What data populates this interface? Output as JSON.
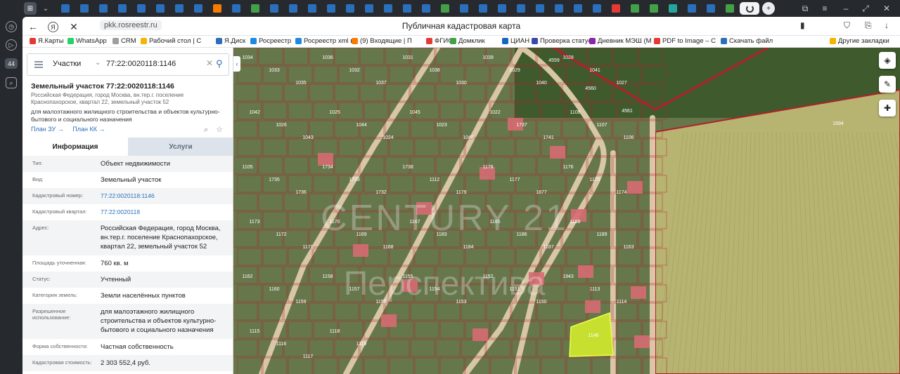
{
  "browser": {
    "page_title": "Публичная кадастровая карта",
    "url": "pkk.rosreestr.ru",
    "sidebar_badge": "44",
    "bookmarks": [
      {
        "label": "Я.Карты",
        "color": "#e53935"
      },
      {
        "label": "WhatsApp",
        "color": "#25d366"
      },
      {
        "label": "CRM",
        "color": "#9e9e9e"
      },
      {
        "label": "Рабочий стол | C",
        "color": "#f4b400"
      },
      {
        "label": "Я.Диск",
        "color": "#2b6fba"
      },
      {
        "label": "Росреестр",
        "color": "#1e88e5"
      },
      {
        "label": "Росреестр xml в",
        "color": "#1e88e5"
      },
      {
        "label": "(9) Входящие | П",
        "color": "#f57c00"
      },
      {
        "label": "ФГИС",
        "color": "#e53935"
      },
      {
        "label": "Домклик",
        "color": "#43a047"
      },
      {
        "label": "ЦИАН",
        "color": "#1565c0"
      },
      {
        "label": "Проверка статуса",
        "color": "#3949ab"
      },
      {
        "label": "Дневник МЭШ (М",
        "color": "#8e24aa"
      },
      {
        "label": "PDF to Image – C",
        "color": "#e53935"
      },
      {
        "label": "Скачать файл",
        "color": "#2b6fba"
      },
      {
        "label": "Другие закладки",
        "color": "#f4b400"
      }
    ]
  },
  "search": {
    "type_label": "Участки",
    "query": "77:22:0020118:1146"
  },
  "object": {
    "title": "Земельный участок 77:22:0020118:1146",
    "address_short": "Российская Федерация, город Москва, вн.тер.г. поселение Краснопахорское, квартал 22, земельный участок 52",
    "permitted_use": "для малоэтажного жилищного строительства и объектов культурно-бытового и социального назначения",
    "plan_zu": "План ЗУ →",
    "plan_kk": "План КК →"
  },
  "tabs": {
    "info": "Информация",
    "services": "Услуги"
  },
  "info_rows": [
    {
      "label": "Тип:",
      "value": "Объект недвижимости"
    },
    {
      "label": "Вид:",
      "value": "Земельный участок"
    },
    {
      "label": "Кадастровый номер:",
      "value": "77:22:0020118:1146"
    },
    {
      "label": "Кадастровый квартал:",
      "value": "77:22:0020118"
    },
    {
      "label": "Адрес:",
      "value": "Российская Федерация, город Москва, вн.тер.г. поселение Краснопахорское, квартал 22, земельный участок 52"
    },
    {
      "label": "Площадь уточненная:",
      "value": "760 кв. м"
    },
    {
      "label": "Статус:",
      "value": "Учтенный"
    },
    {
      "label": "Категория земель:",
      "value": "Земли населённых пунктов"
    },
    {
      "label": "Разрешенное использование:",
      "value": "для малоэтажного жилищного строительства и объектов культурно-бытового и социального назначения"
    },
    {
      "label": "Форма собственности:",
      "value": "Частная собственность"
    },
    {
      "label": "Кадастровая стоимость:",
      "value": "2 303 552,4 руб."
    }
  ],
  "map": {
    "watermark_line1": "CENTURY 21",
    "watermark_line2": "Перспектива",
    "parcel_labels": [
      "1034",
      "1033",
      "1035",
      "1036",
      "1032",
      "1037",
      "1031",
      "1038",
      "1030",
      "1039",
      "1029",
      "1040",
      "1028",
      "1041",
      "1027",
      "1042",
      "1026",
      "1043",
      "1025",
      "1044",
      "1024",
      "1045",
      "1023",
      "1046",
      "1022",
      "1737",
      "1741",
      "1108",
      "1107",
      "1106",
      "1105",
      "1735",
      "1736",
      "1734",
      "1733",
      "1732",
      "1738",
      "1112",
      "1179",
      "1178",
      "1177",
      "1877",
      "1176",
      "1175",
      "1174",
      "1173",
      "1172",
      "1171",
      "1170",
      "1169",
      "1168",
      "1167",
      "1183",
      "1184",
      "1185",
      "1186",
      "1187",
      "1188",
      "1189",
      "1163",
      "1162",
      "1160",
      "1159",
      "1158",
      "1157",
      "1156",
      "1155",
      "1154",
      "1153",
      "1152",
      "1151",
      "1150",
      "1146",
      "1943",
      "1113",
      "1114",
      "1115",
      "1116",
      "1117",
      "1118",
      "1119",
      "4561",
      "4560",
      "4559",
      "1694"
    ],
    "selected_parcel": "1146",
    "colors": {
      "parcel_border": "#b2202a",
      "road": "#d8c6a6",
      "selected": "#c7e02f",
      "field": "#b7b472"
    }
  }
}
